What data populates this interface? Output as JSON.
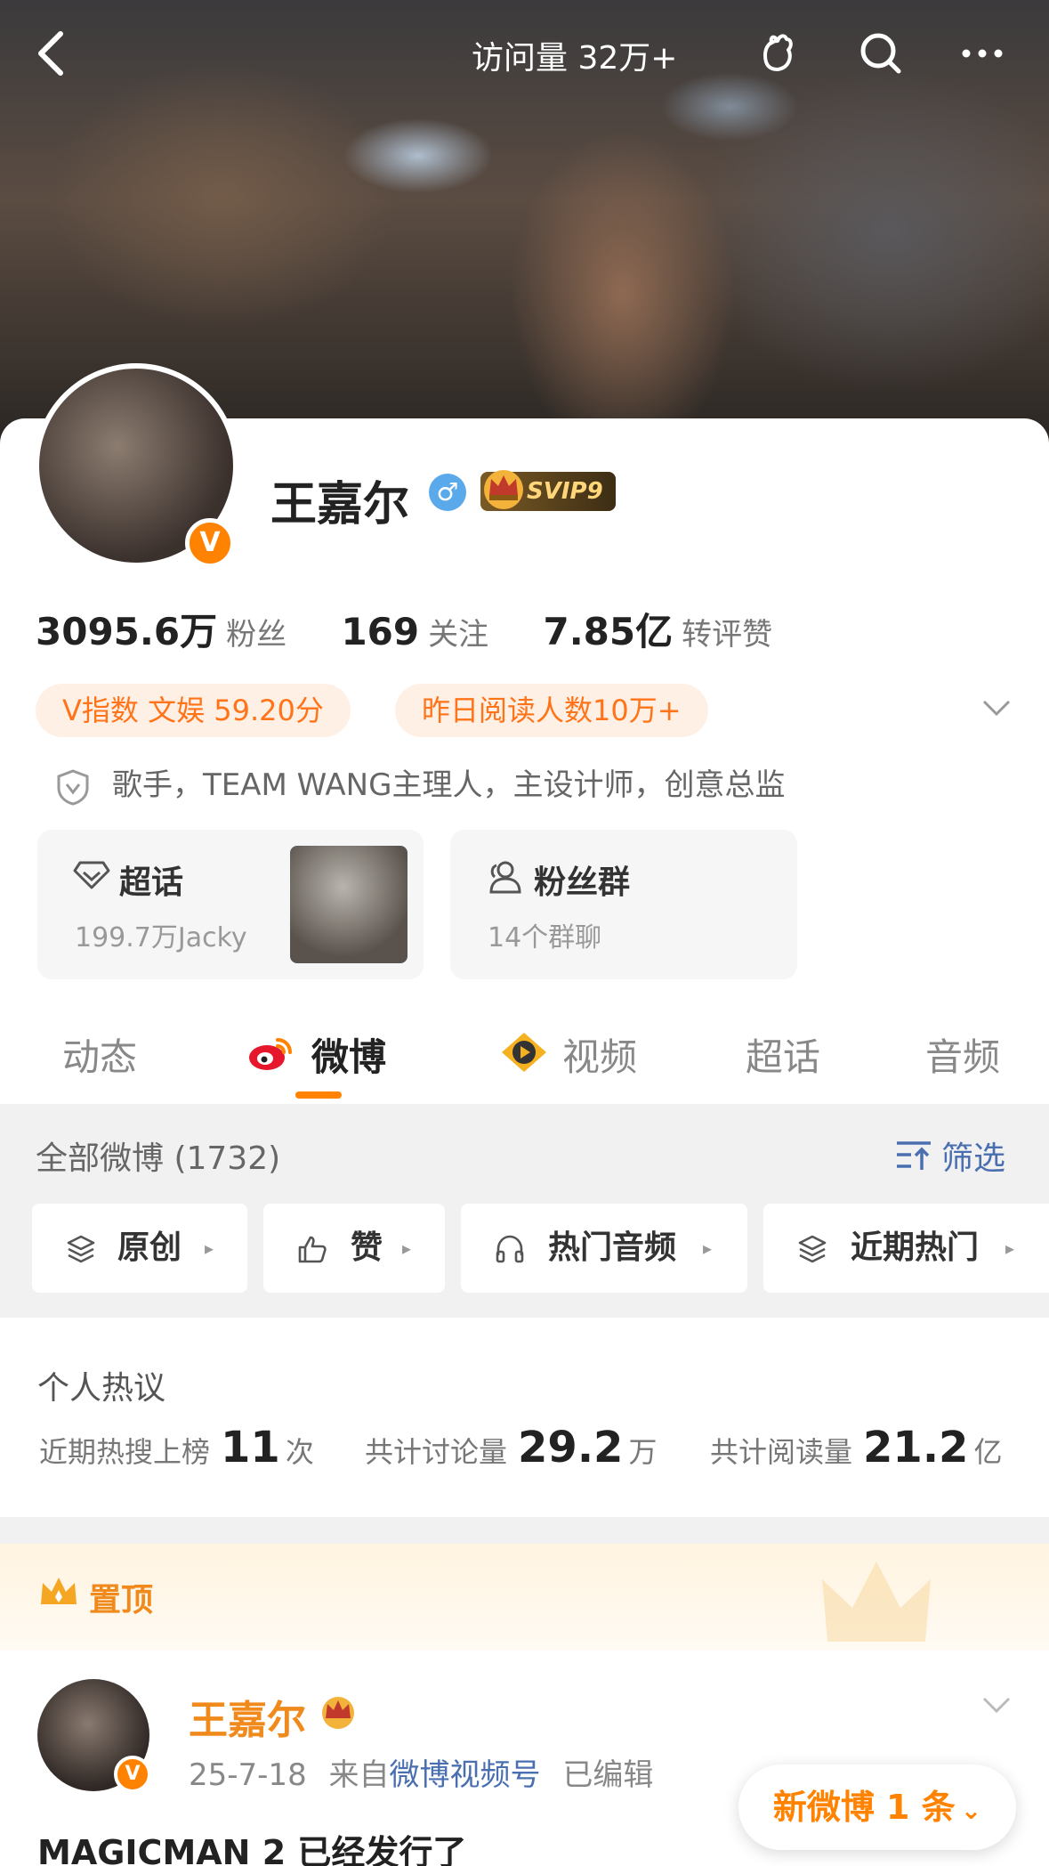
{
  "topbar": {
    "visit_count": "访问量 32万+"
  },
  "profile": {
    "name": "王嘉尔",
    "gender_symbol": "♂",
    "vip_label": "SVIP9",
    "verified_mark": "V"
  },
  "stats": [
    {
      "value": "3095.6万",
      "label": "粉丝"
    },
    {
      "value": "169",
      "label": "关注"
    },
    {
      "value": "7.85亿",
      "label": "转评赞"
    }
  ],
  "pills": {
    "v_index": "V指数 文娱 59.20分",
    "readers": "昨日阅读人数10万+"
  },
  "bio": "歌手，TEAM WANG主理人，主设计师，创意总监",
  "supertopic": {
    "title": "超话",
    "sub": "199.7万Jacky"
  },
  "fangroup": {
    "title": "粉丝群",
    "sub": "14个群聊"
  },
  "tabs": [
    "动态",
    "微博",
    "视频",
    "超话",
    "音频"
  ],
  "feed": {
    "all_label": "全部微博 (1732)",
    "filter_label": "筛选",
    "chips": [
      "原创",
      "赞",
      "热门音频",
      "近期热门"
    ]
  },
  "hot": {
    "title": "个人热议",
    "items": [
      {
        "label": "近期热搜上榜",
        "value": "11",
        "unit": "次"
      },
      {
        "label": "共计讨论量",
        "value": "29.2",
        "unit": "万"
      },
      {
        "label": "共计阅读量",
        "value": "21.2",
        "unit": "亿"
      }
    ]
  },
  "pinned": {
    "label": "置顶"
  },
  "post": {
    "author": "王嘉尔",
    "date": "25-7-18",
    "from_prefix": "来自",
    "source": "微博视频号",
    "edited": "已编辑",
    "text": "MAGICMAN 2 已经发行了",
    "v_mark": "V"
  },
  "new_post_button": "新微博 1 条",
  "colors": {
    "accent": "#ff8200",
    "link": "#4a6fb0",
    "pill_bg": "#fff0e6"
  }
}
